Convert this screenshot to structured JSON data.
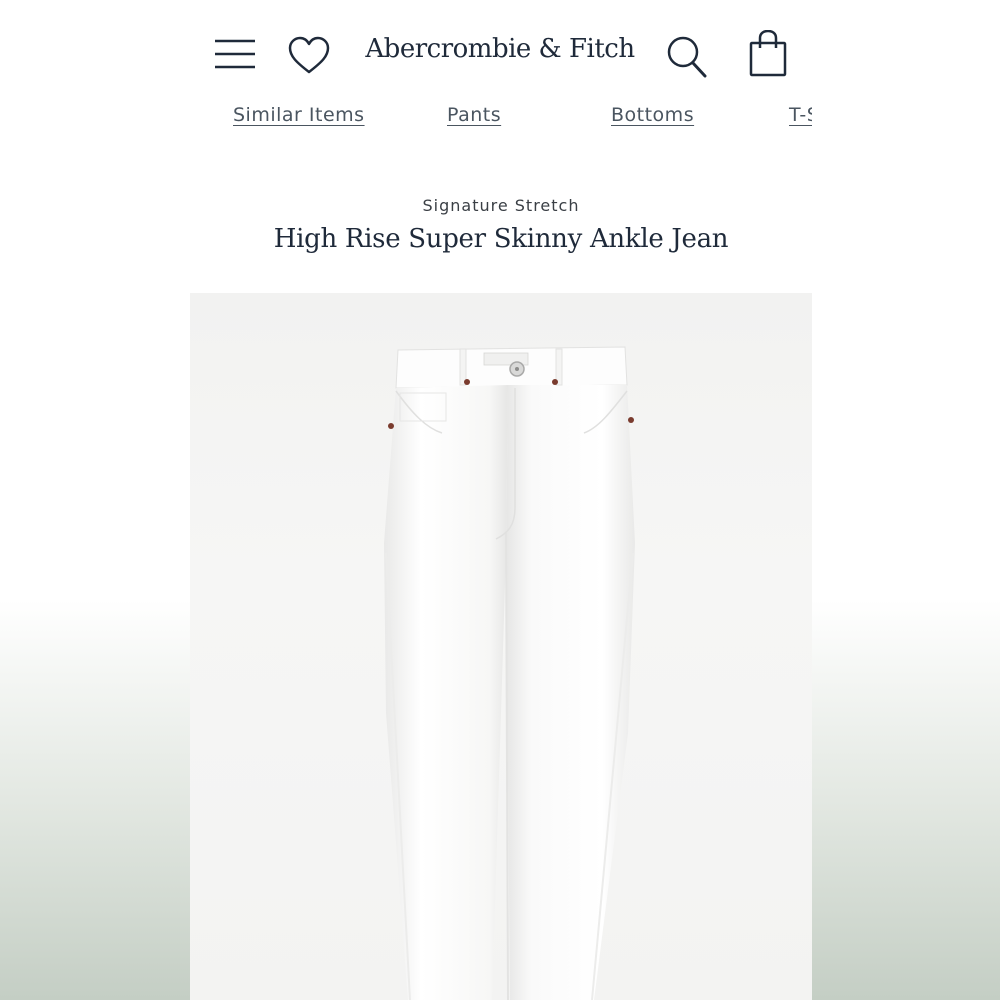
{
  "header": {
    "brand": "Abercrombie & Fitch",
    "icons": [
      "menu-icon",
      "heart-icon",
      "search-icon",
      "shopping-bag-icon"
    ]
  },
  "nav_tabs": [
    {
      "label": "Similar Items"
    },
    {
      "label": "Pants"
    },
    {
      "label": "Bottoms"
    },
    {
      "label": "T-S"
    }
  ],
  "product": {
    "collection": "Signature Stretch",
    "name": "High Rise Super Skinny Ankle Jean",
    "image": "white-jeans"
  },
  "colors": {
    "text_dark": "#1f2a3a",
    "tab_text": "#4a5560",
    "rivet": "#7a3b2e"
  }
}
